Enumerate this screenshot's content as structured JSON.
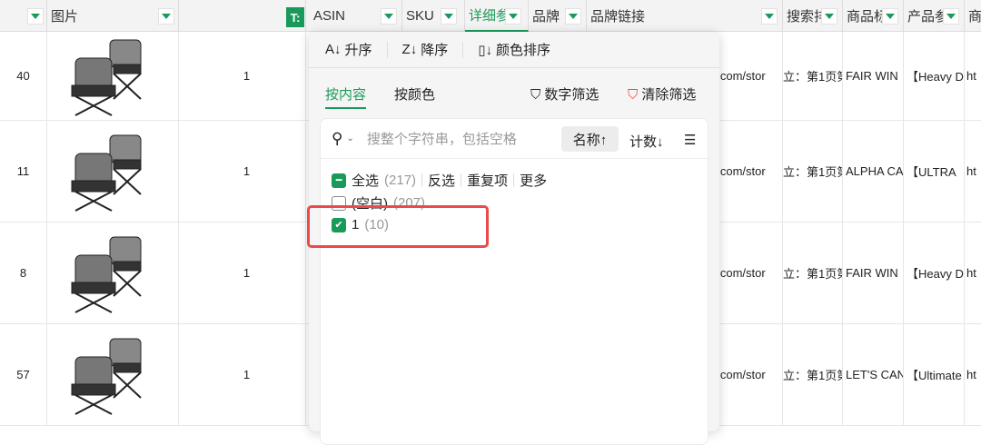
{
  "header": {
    "columns": [
      "图片",
      "ASIN",
      "SKU",
      "详细参",
      "品牌",
      "品牌链接",
      "搜索排",
      "商品标",
      "产品参",
      "商"
    ]
  },
  "rows": [
    {
      "index": "40",
      "value": "1",
      "link": "n.com/stor",
      "rank": "立：第1页第",
      "brand": "FAIR WIN",
      "title": "【Heavy D",
      "url": "ht"
    },
    {
      "index": "11",
      "value": "1",
      "link": "n.com/stor",
      "rank": "立：第1页第",
      "brand": "ALPHA CA",
      "title": "【ULTRA",
      "url": "ht"
    },
    {
      "index": "8",
      "value": "1",
      "link": "n.com/stor",
      "rank": "立：第1页第",
      "brand": "FAIR WIN",
      "title": "【Heavy D",
      "url": "ht"
    },
    {
      "index": "57",
      "value": "1",
      "link": "n.com/stor",
      "rank": "立：第1页第",
      "brand": "LET'S CAN",
      "title": "【Ultimate",
      "url": "ht"
    }
  ],
  "filter_popup": {
    "sort": {
      "asc": "升序",
      "desc": "降序",
      "color": "颜色排序"
    },
    "tabs": {
      "by_content": "按内容",
      "by_color": "按颜色"
    },
    "number_filter": "数字筛选",
    "clear_filter": "清除筛选",
    "search_placeholder": "搜整个字符串，包括空格",
    "sort_name": "名称↑",
    "sort_count": "计数↓",
    "select_all": "全选",
    "select_all_count": "(217)",
    "invert": "反选",
    "duplicates": "重复项",
    "more": "更多",
    "items": [
      {
        "label": "(空白)",
        "count": "(207)",
        "checked": false
      },
      {
        "label": "1",
        "count": "(10)",
        "checked": true
      }
    ]
  },
  "colors": {
    "accent": "#1a9a5a",
    "highlight": "#e94a4a"
  }
}
